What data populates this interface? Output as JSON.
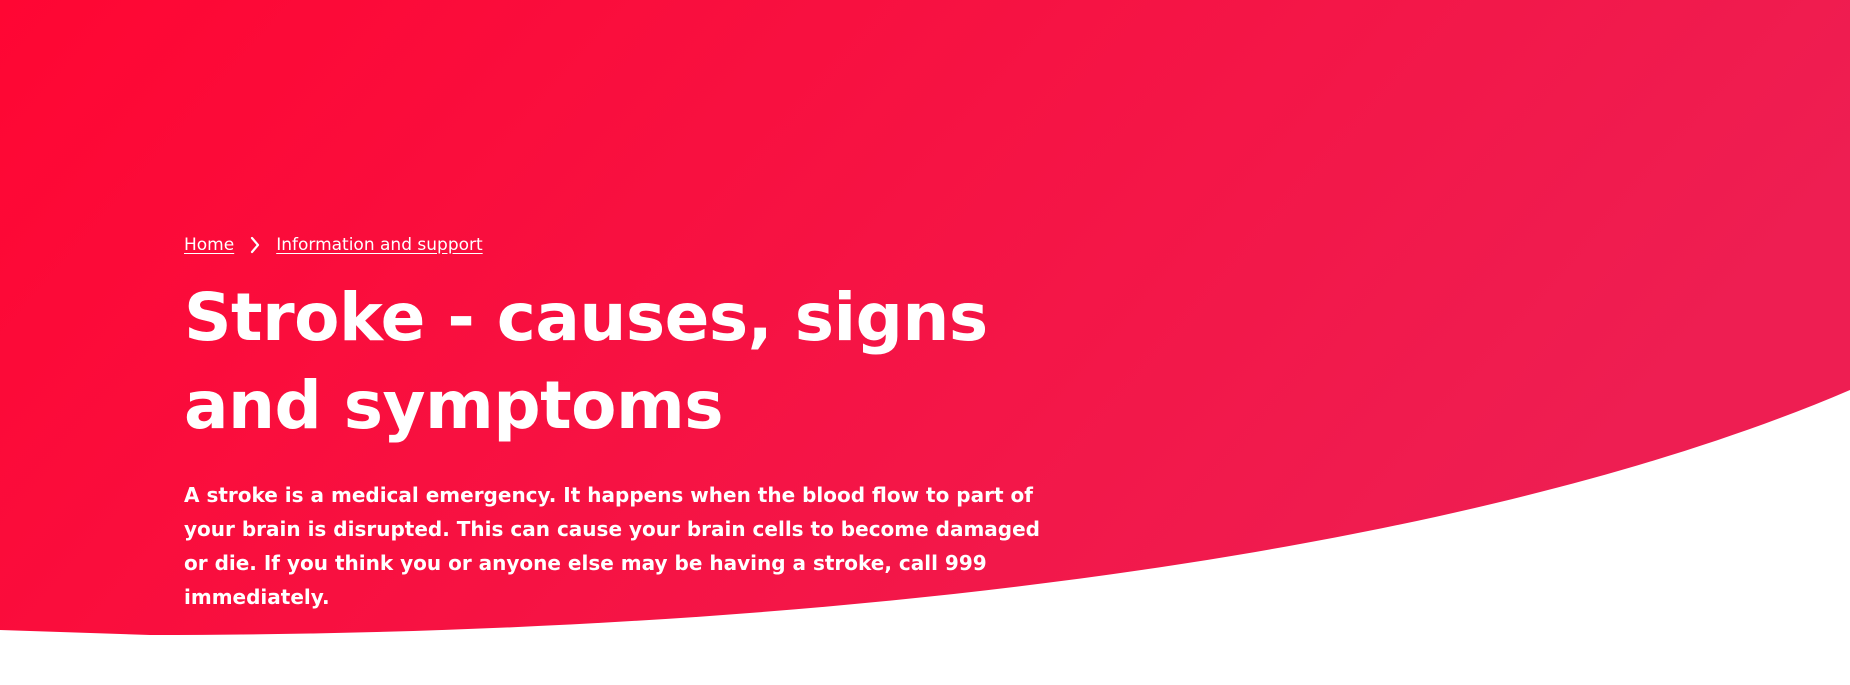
{
  "breadcrumb": {
    "home_label": "Home",
    "section_label": "Information and support"
  },
  "hero": {
    "title": "Stroke - causes, signs and symptoms",
    "intro": "A stroke is a medical emergency. It happens when the blood flow to part of your brain is disrupted. This can cause your brain cells to become damaged or die. If you think you or anyone else may be having a stroke, call 999 immediately."
  },
  "colors": {
    "hero_gradient_start": "#ff0633",
    "hero_gradient_end": "#ee1e52",
    "text": "#ffffff",
    "page_background": "#ffffff"
  },
  "icons": {
    "breadcrumb_separator": "chevron-right-icon"
  }
}
